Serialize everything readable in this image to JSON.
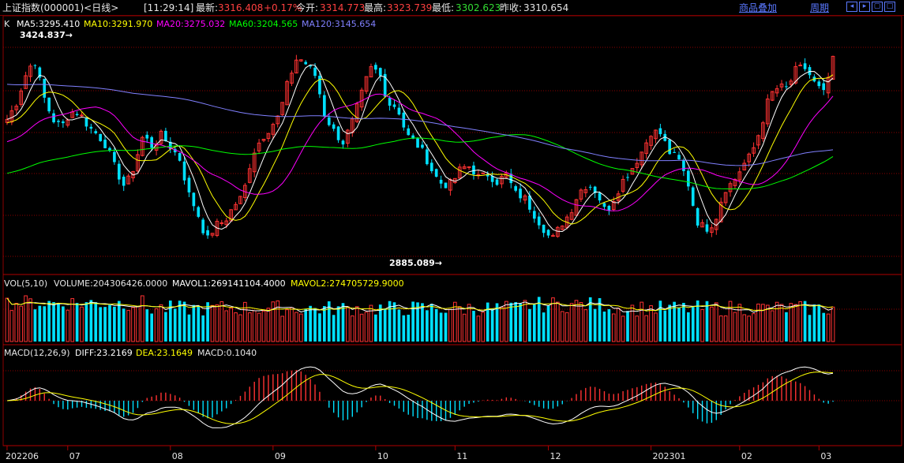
{
  "header": {
    "title": "上证指数(000001)<日线>",
    "time": "[11:29:14]",
    "latest_label": "最新:",
    "latest_value": "3316.408",
    "change": "+0.17%",
    "open_label": "今开:",
    "open_value": "3314.773",
    "high_label": "最高:",
    "high_value": "3323.739",
    "low_label": "最低:",
    "low_value": "3302.623",
    "prev_label": "昨收:",
    "prev_value": "3310.654",
    "overlay_button": "商品叠加",
    "period_button": "周期"
  },
  "colors": {
    "up": "#ff3232",
    "down": "#00e0ff",
    "ma5": "#ffffff",
    "ma10": "#ffff00",
    "ma20": "#ff00ff",
    "ma60": "#00ff00",
    "ma120": "#8080ff",
    "grid": "#8b0000",
    "diff": "#ffffff",
    "dea": "#ffff00"
  },
  "price_panel": {
    "k_label": "K",
    "ma5": "MA5:3295.410",
    "ma10": "MA10:3291.970",
    "ma20": "MA20:3275.032",
    "ma60": "MA60:3204.565",
    "ma120": "MA120:3145.654",
    "high_annotation": "3424.837→",
    "low_annotation": "2885.089→"
  },
  "volume_panel": {
    "vol_label": "VOL(5,10)",
    "volume": "VOLUME:204306426.0000",
    "mavol1": "MAVOL1:269141104.4000",
    "mavol2": "MAVOL2:274705729.9000"
  },
  "macd_panel": {
    "label": "MACD(12,26,9)",
    "diff": "DIFF:23.2169",
    "dea": "DEA:23.1649",
    "macd": "MACD:0.1040"
  },
  "x_axis": {
    "labels": [
      "202206",
      "07",
      "08",
      "09",
      "10",
      "11",
      "12",
      "202301",
      "02",
      "03"
    ]
  },
  "chart_data": {
    "type": "candlestick",
    "title": "上证指数(000001)<日线>",
    "period": "daily",
    "x_range": [
      "2022-06",
      "2023-03"
    ],
    "price_extremes": {
      "high": 3424.837,
      "low": 2885.089
    },
    "month_ticks": [
      "202206",
      "07",
      "08",
      "09",
      "10",
      "11",
      "12",
      "202301",
      "02",
      "03"
    ],
    "close_waypoints": [
      3240,
      3280,
      3350,
      3395,
      3300,
      3240,
      3220,
      3260,
      3255,
      3220,
      3200,
      3170,
      3110,
      3065,
      3120,
      3200,
      3170,
      3200,
      3170,
      3140,
      3050,
      3000,
      2930,
      2970,
      2980,
      3020,
      3045,
      3150,
      3190,
      3220,
      3250,
      3340,
      3400,
      3380,
      3350,
      3250,
      3210,
      3180,
      3230,
      3300,
      3370,
      3360,
      3280,
      3272,
      3200,
      3180,
      3150,
      3100,
      3072,
      3076,
      3115,
      3120,
      3090,
      3100,
      3080,
      3100,
      3050,
      3040,
      3000,
      2965,
      2930,
      2970,
      3000,
      3055,
      3075,
      3053,
      3000,
      3045,
      3090,
      3120,
      3160,
      3210,
      3203,
      3155,
      3135,
      3080,
      2980,
      2960,
      2980,
      3060,
      3080,
      3120,
      3150,
      3215,
      3300,
      3322,
      3320,
      3370,
      3370,
      3330,
      3305,
      3390
    ],
    "ma5_last": 3295.41,
    "ma10_last": 3291.97,
    "ma20_last": 3275.032,
    "ma60_last": 3204.565,
    "ma120_last": 3145.654,
    "volume_last": 204306426.0,
    "mavol1_last": 269141104.4,
    "mavol2_last": 274705729.9,
    "diff_last": 23.2169,
    "dea_last": 23.1649,
    "macd_last": 0.104
  }
}
